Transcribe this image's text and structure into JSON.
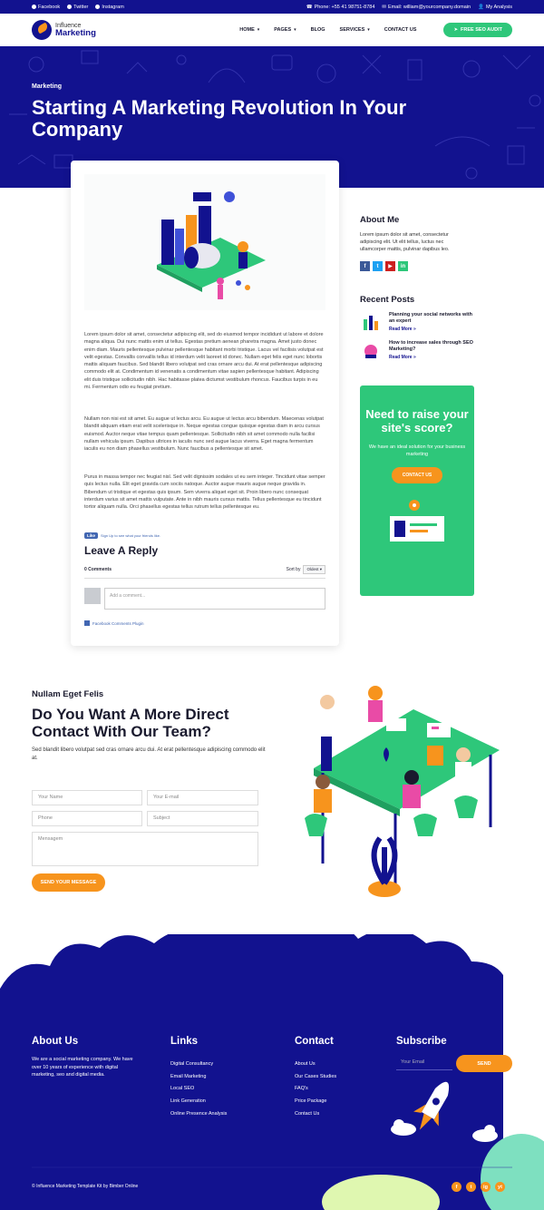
{
  "topbar": {
    "social": [
      {
        "label": "Facebook"
      },
      {
        "label": "Twitter"
      },
      {
        "label": "Instagram"
      }
    ],
    "phone": "Phone: +55 41 98751-8784",
    "email": "Email: william@yourcompany.domain",
    "account": "My Analysis"
  },
  "nav": {
    "logo_line1": "Influence",
    "logo_line2": "Marketing",
    "items": [
      {
        "label": "HOME"
      },
      {
        "label": "PAGES"
      },
      {
        "label": "BLOG"
      },
      {
        "label": "SERVICES"
      },
      {
        "label": "CONTACT US"
      }
    ],
    "cta": "FREE SEO AUDIT"
  },
  "hero": {
    "category": "Marketing",
    "title": "Starting A Marketing Revolution In Your Company"
  },
  "article": {
    "paragraphs": [
      "Lorem ipsum dolor sit amet, consectetur adipiscing elit, sed do eiusmod tempor incididunt ut labore et dolore magna aliqua. Dui nunc mattis enim ut tellus. Egestas pretium aenean pharetra magna. Amet justo donec enim diam. Mauris pellentesque pulvinar pellentesque habitant morbi tristique. Lacus vel facilisis volutpat est velit egestas. Convallis convallis tellus id interdum velit laoreet id donec. Nullam eget felis eget nunc lobortis mattis aliquam faucibus. Sed blandit libero volutpat sed cras ornare arcu dui. At erat pellentesque adipiscing commodo elit at. Condimentum id venenatis a condimentum vitae sapien pellentesque habitant. Adipiscing elit duis tristique sollicitudin nibh. Hac habitasse platea dictumst vestibulum rhoncus. Faucibus turpis in eu mi. Fermentum odio eu feugiat pretium.",
      "Nullam non nisi est sit amet. Eu augue ut lectus arcu. Eu augue ut lectus arcu bibendum. Maecenas volutpat blandit aliquam etiam erat velit scelerisque in. Neque egestas congue quisque egestas diam in arcu cursus euismod. Auctor neque vitae tempus quam pellentesque. Sollicitudin nibh sit amet commodo nulla facilisi nullam vehicula ipsum. Dapibus ultrices in iaculis nunc sed augue lacus viverra. Eget magna fermentum iaculis eu non diam phasellus vestibulum. Nunc faucibus a pellentesque sit amet.",
      "Purus in massa tempor nec feugiat nisl. Sed velit dignissim sodales ut eu sem integer. Tincidunt vitae semper quis lectus nulla. Elit eget gravida cum sociis natoque. Auctor augue mauris augue neque gravida in. Bibendum ut tristique et egestas quis ipsum. Sem viverra aliquet eget sit. Proin libero nunc consequat interdum varius sit amet mattis vulputate. Ante in nibh mauris cursus mattis. Tellus pellentesque eu tincidunt tortor aliquam nulla. Orci phasellus egestas tellus rutrum tellus pellentesque eu."
    ],
    "fb_like": "Like",
    "fb_like_text": "Sign Up to see what your friends like.",
    "reply_heading": "Leave A Reply",
    "comments_count": "0 Comments",
    "sort_label": "Sort by",
    "sort_value": "Oldest",
    "comment_placeholder": "Add a comment...",
    "fb_plugin": "Facebook Comments Plugin"
  },
  "sidebar": {
    "about_title": "About Me",
    "about_text": "Lorem ipsum dolor sit amet, consectetur adipiscing elit. Ut elit tellus, luctus nec ullamcorper mattis, pulvinar dapibus leo.",
    "social": [
      {
        "icon": "facebook-icon",
        "glyph": "f",
        "color": "#3b5998"
      },
      {
        "icon": "twitter-icon",
        "glyph": "t",
        "color": "#1da1f2"
      },
      {
        "icon": "youtube-icon",
        "glyph": "▶",
        "color": "#cd201f"
      },
      {
        "icon": "linkedin-icon",
        "glyph": "in",
        "color": "#2ec77a"
      }
    ],
    "recent_title": "Recent Posts",
    "posts": [
      {
        "title": "Planning your social networks with an expert",
        "more": "Read More »"
      },
      {
        "title": "How to increase sales through SEO Marketing?",
        "more": "Read More »"
      }
    ],
    "cta_title": "Need to raise your site's score?",
    "cta_text": "We have an ideal solution for your business marketing",
    "cta_button": "CONTACT US"
  },
  "contact": {
    "pre": "Nullam Eget Felis",
    "title": "Do You Want A More Direct Contact With Our Team?",
    "text": "Sed blandit libero volutpat sed cras ornare arcu dui. At erat pellentesque adipiscing commodo elit at.",
    "fields": {
      "name": "Your Name",
      "email": "Your E-mail",
      "phone": "Phone",
      "subject": "Subject",
      "message": "Mensagem"
    },
    "button": "SEND YOUR MESSAGE"
  },
  "footer": {
    "about_title": "About Us",
    "about_text": "We are a social marketing company. We have over 10 years of experience with digital marketing, seo and digital media.",
    "links_title": "Links",
    "links": [
      "Digital Consultancy",
      "Email Marketing",
      "Local SEO",
      "Link Generation",
      "Online Presence Analysis"
    ],
    "contact_title": "Contact",
    "contact_links": [
      "About Us",
      "Our Cases Studies",
      "FAQ's",
      "Price Package",
      "Contact Us"
    ],
    "subscribe_title": "Subscribe",
    "subscribe_placeholder": "Your Email",
    "subscribe_button": "SEND",
    "copyright": "© Influence Marketing Template Kit by Bimber Online",
    "social": [
      "f",
      "t",
      "ig",
      "yt"
    ]
  },
  "colors": {
    "navy": "#12128f",
    "green": "#2ec77a",
    "orange": "#f7941d"
  }
}
